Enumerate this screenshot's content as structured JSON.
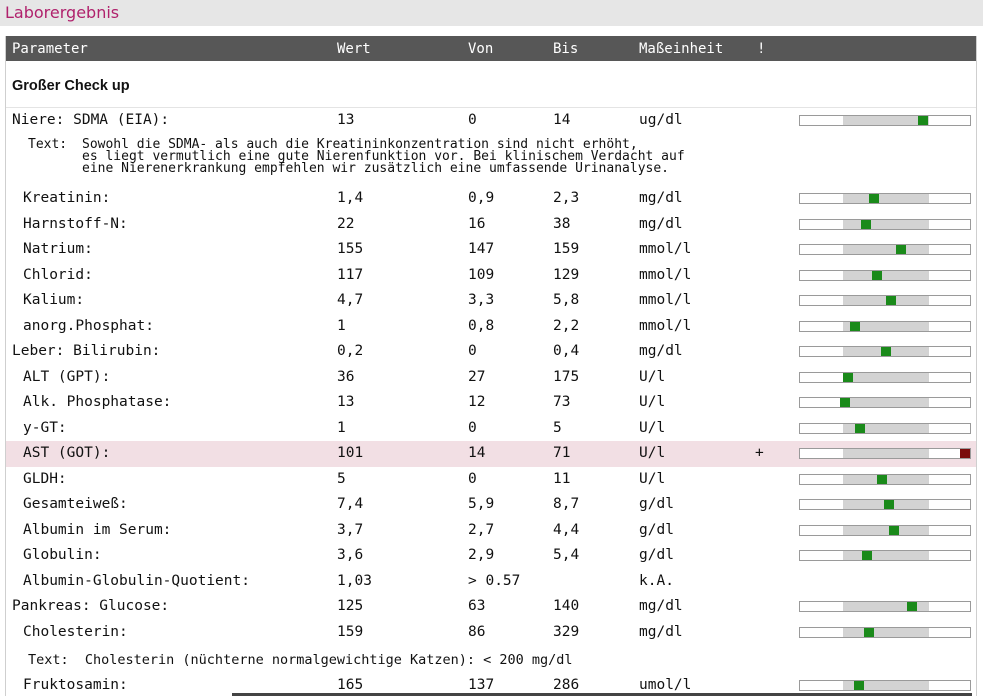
{
  "window": {
    "title": "Laborergebnis"
  },
  "table": {
    "headers": {
      "param": "Parameter",
      "wert": "Wert",
      "von": "Von",
      "bis": "Bis",
      "einheit": "Maßeinheit",
      "flag": "!"
    },
    "section": "Großer Check up",
    "rows": [
      {
        "name": "Niere: SDMA (EIA):",
        "wert": "13",
        "von": "0",
        "bis": "14",
        "einheit": "ug/dl",
        "flag": "",
        "level": 0.93,
        "indent": false
      },
      {
        "name": "Kreatinin:",
        "wert": "1,4",
        "von": "0,9",
        "bis": "2,3",
        "einheit": "mg/dl",
        "flag": "",
        "level": 0.36,
        "indent": true
      },
      {
        "name": "Harnstoff-N:",
        "wert": "22",
        "von": "16",
        "bis": "38",
        "einheit": "mg/dl",
        "flag": "",
        "level": 0.27,
        "indent": true
      },
      {
        "name": "Natrium:",
        "wert": "155",
        "von": "147",
        "bis": "159",
        "einheit": "mmol/l",
        "flag": "",
        "level": 0.67,
        "indent": true
      },
      {
        "name": "Chlorid:",
        "wert": "117",
        "von": "109",
        "bis": "129",
        "einheit": "mmol/l",
        "flag": "",
        "level": 0.4,
        "indent": true
      },
      {
        "name": "Kalium:",
        "wert": "4,7",
        "von": "3,3",
        "bis": "5,8",
        "einheit": "mmol/l",
        "flag": "",
        "level": 0.56,
        "indent": true
      },
      {
        "name": "anorg.Phosphat:",
        "wert": "1",
        "von": "0,8",
        "bis": "2,2",
        "einheit": "mmol/l",
        "flag": "",
        "level": 0.14,
        "indent": true
      },
      {
        "name": "Leber: Bilirubin:",
        "wert": "0,2",
        "von": "0",
        "bis": "0,4",
        "einheit": "mg/dl",
        "flag": "",
        "level": 0.5,
        "indent": false
      },
      {
        "name": "ALT (GPT):",
        "wert": "36",
        "von": "27",
        "bis": "175",
        "einheit": "U/l",
        "flag": "",
        "level": 0.06,
        "indent": true
      },
      {
        "name": "Alk. Phosphatase:",
        "wert": "13",
        "von": "12",
        "bis": "73",
        "einheit": "U/l",
        "flag": "",
        "level": 0.02,
        "indent": true
      },
      {
        "name": "y-GT:",
        "wert": "1",
        "von": "0",
        "bis": "5",
        "einheit": "U/l",
        "flag": "",
        "level": 0.2,
        "indent": true
      },
      {
        "name": "AST (GOT):",
        "wert": "101",
        "von": "14",
        "bis": "71",
        "einheit": "U/l",
        "flag": "+",
        "level": 2.4,
        "indent": true
      },
      {
        "name": "GLDH:",
        "wert": "5",
        "von": "0",
        "bis": "11",
        "einheit": "U/l",
        "flag": "",
        "level": 0.45,
        "indent": true
      },
      {
        "name": "Gesamteiweß:",
        "wert": "7,4",
        "von": "5,9",
        "bis": "8,7",
        "einheit": "g/dl",
        "flag": "",
        "level": 0.54,
        "indent": true
      },
      {
        "name": "Albumin im Serum:",
        "wert": "3,7",
        "von": "2,7",
        "bis": "4,4",
        "einheit": "g/dl",
        "flag": "",
        "level": 0.59,
        "indent": true
      },
      {
        "name": "Globulin:",
        "wert": "3,6",
        "von": "2,9",
        "bis": "5,4",
        "einheit": "g/dl",
        "flag": "",
        "level": 0.28,
        "indent": true
      },
      {
        "name": "Albumin-Globulin-Quotient:",
        "wert": "1,03",
        "von": "> 0.57",
        "bis": "",
        "einheit": "k.A.",
        "flag": "",
        "level": null,
        "indent": true
      },
      {
        "name": "Pankreas: Glucose:",
        "wert": "125",
        "von": "63",
        "bis": "140",
        "einheit": "mg/dl",
        "flag": "",
        "level": 0.8,
        "indent": false
      },
      {
        "name": "Cholesterin:",
        "wert": "159",
        "von": "86",
        "bis": "329",
        "einheit": "mg/dl",
        "flag": "",
        "level": 0.3,
        "indent": true
      },
      {
        "name": "Fruktosamin:",
        "wert": "165",
        "von": "137",
        "bis": "286",
        "einheit": "umol/l",
        "flag": "",
        "level": 0.19,
        "indent": true
      }
    ],
    "notes": {
      "sdma_label": "Text:",
      "sdma_line1": "Sowohl die SDMA- als auch die Kreatininkonzentration sind nicht erhöht,",
      "sdma_line2": "es liegt vermutlich eine gute Nierenfunktion vor. Bei klinischem Verdacht auf",
      "sdma_line3": "eine Nierenerkrankung empfehlen wir zusätzlich eine umfassende Urinanalyse.",
      "chol": "Text:  Cholesterin (nüchterne normalgewichtige Katzen): < 200 mg/dl"
    }
  }
}
